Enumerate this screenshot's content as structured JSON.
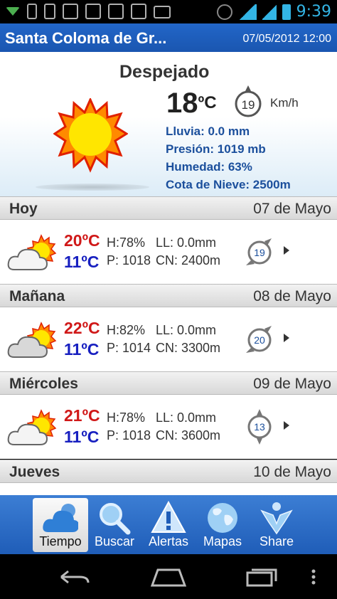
{
  "status_bar": {
    "time": "9:39"
  },
  "header": {
    "location": "Santa Coloma de Gr...",
    "datetime": "07/05/2012 12:00"
  },
  "current": {
    "condition": "Despejado",
    "temp_value": "18",
    "temp_unit": "ºC",
    "wind_speed": "19",
    "wind_unit": "Km/h",
    "lluvia": "Lluvia: 0.0 mm",
    "presion": "Presión: 1019 mb",
    "humedad": "Humedad: 63%",
    "cota": "Cota de Nieve: 2500m"
  },
  "days": [
    {
      "name": "Hoy",
      "date": "07 de Mayo",
      "tmax": "20ºC",
      "tmin": "11ºC",
      "h": "H:78%",
      "p": "P: 1018",
      "ll": "LL:  0.0mm",
      "cn": "CN: 2400m",
      "wind": "19"
    },
    {
      "name": "Mañana",
      "date": "08 de Mayo",
      "tmax": "22ºC",
      "tmin": "11ºC",
      "h": "H:82%",
      "p": "P: 1014",
      "ll": "LL:  0.0mm",
      "cn": "CN: 3300m",
      "wind": "20"
    },
    {
      "name": "Miércoles",
      "date": "09 de Mayo",
      "tmax": "21ºC",
      "tmin": "11ºC",
      "h": "H:78%",
      "p": "P: 1018",
      "ll": "LL:  0.0mm",
      "cn": "CN: 3600m",
      "wind": "13"
    },
    {
      "name": "Jueves",
      "date": "10 de Mayo"
    }
  ],
  "nav": {
    "tiempo": "Tiempo",
    "buscar": "Buscar",
    "alertas": "Alertas",
    "mapas": "Mapas",
    "share": "Share"
  },
  "colors": {
    "header_blue": "#1a56b0",
    "max_red": "#d01818",
    "min_blue": "#1820c0",
    "info_blue": "#1b4f9c"
  }
}
